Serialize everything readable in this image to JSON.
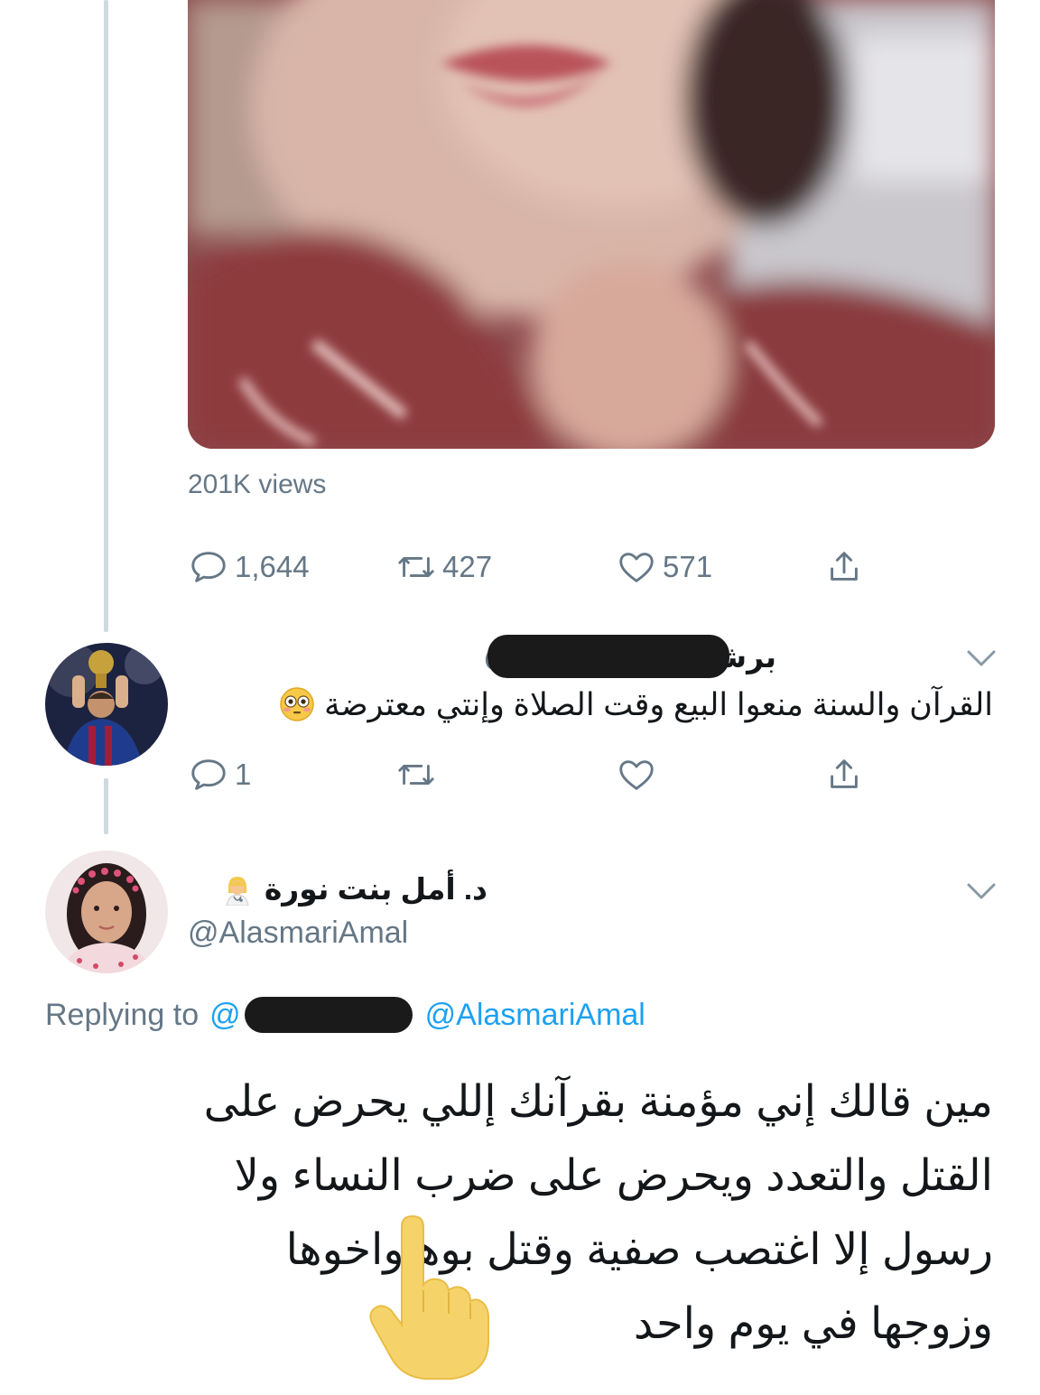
{
  "video": {
    "views_text": "201K views"
  },
  "original_tweet_actions": {
    "reply_count": "1,644",
    "retweet_count": "427",
    "like_count": "571"
  },
  "reply_one": {
    "display_name": "برشلوني ميساوي",
    "at_symbol": "@",
    "text": "القرآن والسنة منعوا البيع وقت الصلاة وإنتي معترضة",
    "emoji": "flushed-face",
    "reply_count": "1"
  },
  "reply_two": {
    "display_name": "د. أمل بنت نورة",
    "emoji": "woman-health-worker",
    "handle": "@AlasmariAmal",
    "replying_label": "Replying to",
    "replying_at": "@",
    "replying_handle": "@AlasmariAmal",
    "lines": [
      "مين قالك إني مؤمنة بقرآنك إللي يحرض على",
      "القتل والتعدد ويحرض على ضرب النساء ولا",
      "رسول إلا اغتصب صفية وقتل بوهاواخوها",
      "وزوجها في يوم واحد"
    ]
  },
  "icons": {
    "reply": "speech-bubble-icon",
    "retweet": "retweet-icon",
    "like": "heart-icon",
    "share": "share-icon",
    "caret": "chevron-down-icon",
    "pointer": "pointing-hand-icon"
  },
  "colors": {
    "secondary_text": "#657786",
    "link": "#1da1f2",
    "thread_line": "#cfd9de"
  }
}
